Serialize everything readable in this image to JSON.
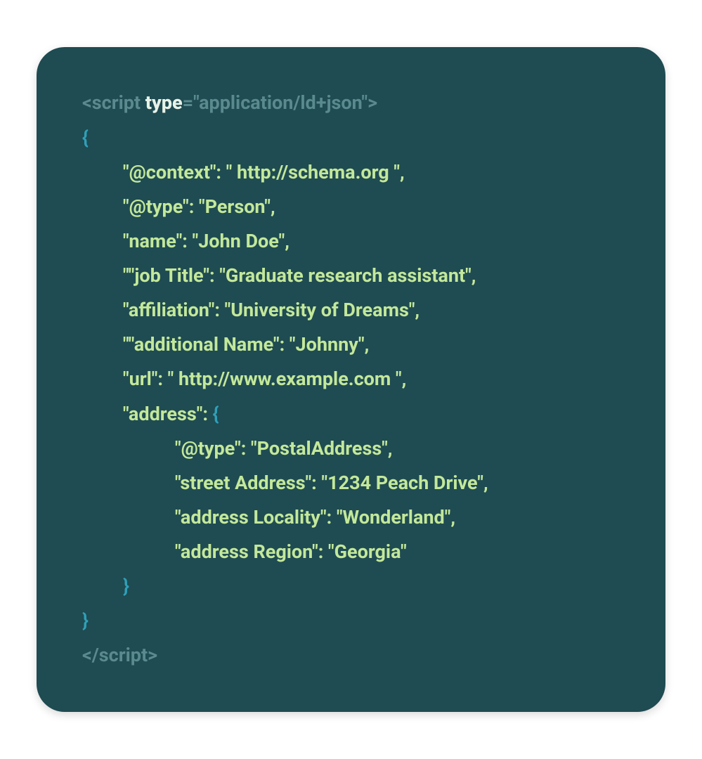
{
  "code": {
    "openTag": {
      "bracket_open": "<",
      "tagName": "script",
      "attrName": " type",
      "equals": "=",
      "attrValue": "\"application/ld+json\"",
      "bracket_close": ">"
    },
    "brace_open_outer": "{",
    "lines": [
      "\"@context\": \" http://schema.org \",",
      "\"@type\": \"Person\",",
      "\"name\": \"John Doe\",",
      "\"\"job Title\": \"Graduate research assistant\",",
      "\"affiliation\": \"University of Dreams\",",
      "\"\"additional Name\": \"Johnny\",",
      "\"url\": \" http://www.example.com \","
    ],
    "address_key": "\"address\": ",
    "brace_open_inner": "{",
    "address_lines": [
      "\"@type\": \"PostalAddress\",",
      "\"street Address\": \"1234 Peach Drive\",",
      "\"address Locality\": \"Wonderland\",",
      "\"address Region\": \"Georgia\""
    ],
    "brace_close_inner": "}",
    "brace_close_outer": "}",
    "closeTag": {
      "bracket_open": "</",
      "tagName": "script",
      "bracket_close": ">"
    }
  }
}
